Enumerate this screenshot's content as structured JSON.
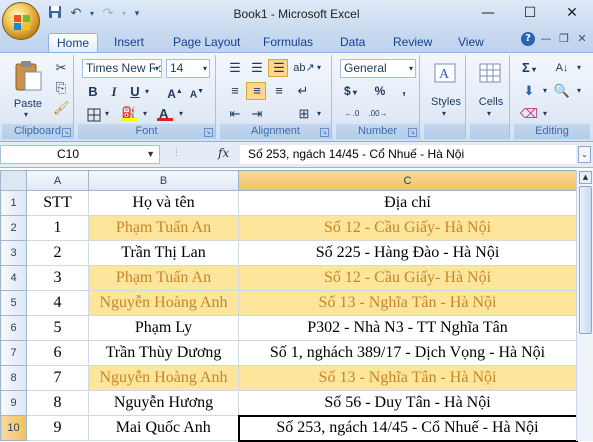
{
  "window": {
    "title": "Book1 - Microsoft Excel",
    "minimize": "—",
    "maximize": "☐",
    "close": "✕"
  },
  "qat": {
    "save_icon": "save-icon",
    "undo_icon": "undo-icon",
    "redo_icon": "redo-icon",
    "customize_icon": "dropdown-icon"
  },
  "tabs": [
    "Home",
    "Insert",
    "Page Layout",
    "Formulas",
    "Data",
    "Review",
    "View"
  ],
  "active_tab": "Home",
  "ribbon": {
    "clipboard": {
      "label": "Clipboard",
      "paste": "Paste"
    },
    "font": {
      "label": "Font",
      "font_name": "Times New Ro",
      "font_size": "14",
      "bold": "B",
      "italic": "I",
      "underline": "U"
    },
    "alignment": {
      "label": "Alignment"
    },
    "number": {
      "label": "Number",
      "format": "General",
      "currency": "$",
      "percent": "%",
      "comma": ","
    },
    "styles": {
      "label": "Styles"
    },
    "cells": {
      "label": "Cells"
    },
    "editing": {
      "label": "Editing",
      "sum": "Σ"
    }
  },
  "formula_bar": {
    "name_box": "C10",
    "fx": "fx",
    "formula": "Số 253, ngách 14/45 - Cổ Nhuế - Hà Nội"
  },
  "sheet": {
    "columns": [
      "A",
      "B",
      "C"
    ],
    "selected_column": "C",
    "selected_row": "10",
    "rows": [
      {
        "row": "1",
        "a": "STT",
        "b": "Họ và tên",
        "c": "Địa chỉ",
        "highlight": false
      },
      {
        "row": "2",
        "a": "1",
        "b": "Phạm Tuấn An",
        "c": "Số 12 - Cầu Giấy- Hà Nội",
        "highlight": true
      },
      {
        "row": "3",
        "a": "2",
        "b": "Trần Thị Lan",
        "c": "Số 225 - Hàng Đào - Hà Nội",
        "highlight": false
      },
      {
        "row": "4",
        "a": "3",
        "b": "Phạm Tuấn An",
        "c": "Số 12 - Cầu Giấy- Hà Nội",
        "highlight": true
      },
      {
        "row": "5",
        "a": "4",
        "b": "Nguyễn Hoàng Anh",
        "c": "Số 13 - Nghĩa Tân - Hà Nội",
        "highlight": true
      },
      {
        "row": "6",
        "a": "5",
        "b": "Phạm Ly",
        "c": "P302 - Nhà N3 - TT Nghĩa Tân",
        "highlight": false
      },
      {
        "row": "7",
        "a": "6",
        "b": "Trần Thùy Dương",
        "c": "Số 1, nghách 389/17 - Dịch Vọng - Hà Nội",
        "highlight": false
      },
      {
        "row": "8",
        "a": "7",
        "b": "Nguyễn Hoàng Anh",
        "c": "Số 13 - Nghĩa Tân - Hà Nội",
        "highlight": true
      },
      {
        "row": "9",
        "a": "8",
        "b": "Nguyễn Hương",
        "c": "Số 56 - Duy Tân - Hà Nội",
        "highlight": false
      },
      {
        "row": "10",
        "a": "9",
        "b": "Mai Quốc Anh",
        "c": "Số 253, ngách 14/45 - Cổ Nhuế - Hà Nội",
        "highlight": false
      }
    ]
  }
}
